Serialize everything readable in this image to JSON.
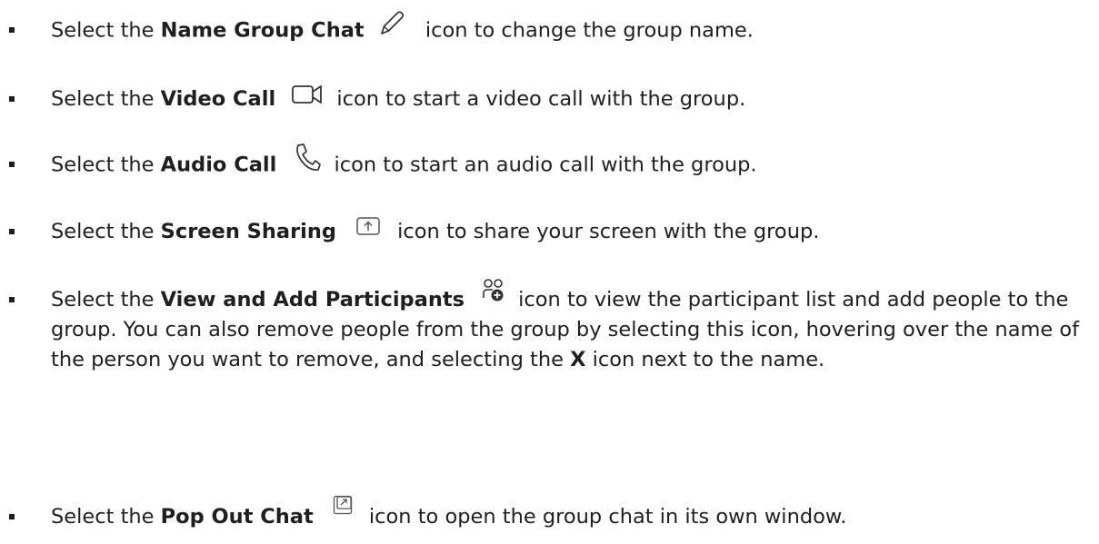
{
  "items": [
    {
      "prefix": "Select the ",
      "bold": "Name Group Chat",
      "icon": "pencil-icon",
      "suffix": "icon to change the group name."
    },
    {
      "prefix": "Select the ",
      "bold": "Video Call",
      "icon": "video-camera-icon",
      "suffix": "icon to start a video call with the group."
    },
    {
      "prefix": "Select the ",
      "bold": "Audio Call",
      "icon": "phone-icon",
      "suffix": "icon to start an audio call with the group."
    },
    {
      "prefix": "Select the ",
      "bold": "Screen Sharing",
      "icon": "screen-share-icon",
      "suffix": "icon to share your screen with the group."
    },
    {
      "prefix": "Select the ",
      "bold": "View and Add Participants",
      "icon": "participants-add-icon",
      "suffix": "icon to view the participant list and add people to the group. You can also remove people from the group by selecting this icon, hovering over the name of the person you want to remove, and selecting the ",
      "bold2": "X",
      "suffix2": " icon next to the name."
    },
    {
      "prefix": "Select the ",
      "bold": "Pop Out Chat",
      "icon": "pop-out-icon",
      "suffix": "icon to open the group chat in its own window."
    }
  ]
}
